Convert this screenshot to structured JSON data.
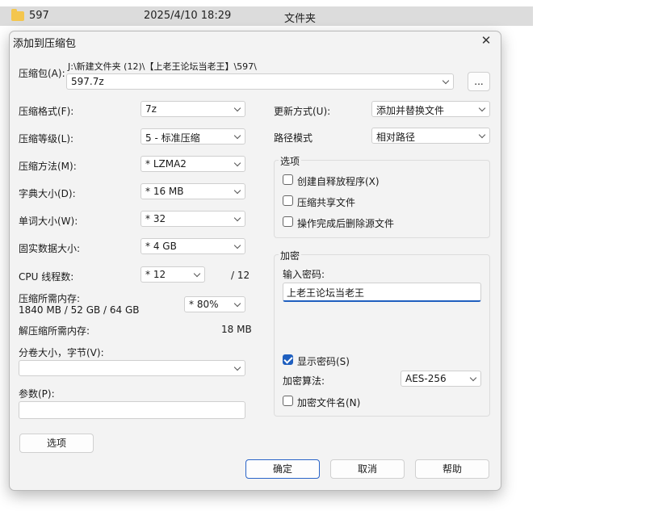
{
  "explorer": {
    "name": "597",
    "date": "2025/4/10 18:29",
    "type": "文件夹"
  },
  "dialog": {
    "title": "添加到压缩包",
    "archive_label": "压缩包(A):",
    "archive_path": "J:\\新建文件夹 (12)\\【上老王论坛当老王】\\597\\",
    "archive_name": "597.7z",
    "browse_label": "...",
    "left": {
      "format": {
        "label": "压缩格式(F):",
        "value": "7z"
      },
      "level": {
        "label": "压缩等级(L):",
        "value": "5 - 标准压缩"
      },
      "method": {
        "label": "压缩方法(M):",
        "value": "* LZMA2"
      },
      "dict": {
        "label": "字典大小(D):",
        "value": "* 16 MB"
      },
      "word": {
        "label": "单词大小(W):",
        "value": "* 32"
      },
      "solid": {
        "label": "固实数据大小:",
        "value": "* 4 GB"
      },
      "threads": {
        "label": "CPU 线程数:",
        "value": "* 12",
        "max": "/ 12"
      },
      "memory": {
        "label": "压缩所需内存:",
        "detail": "1840 MB / 52 GB / 64 GB",
        "value": "* 80%"
      },
      "decomp": {
        "label": "解压缩所需内存:",
        "value": "18 MB"
      },
      "split": {
        "label": "分卷大小，字节(V):",
        "value": ""
      },
      "params": {
        "label": "参数(P):",
        "value": ""
      },
      "options_button": "选项"
    },
    "right": {
      "update": {
        "label": "更新方式(U):",
        "value": "添加并替换文件"
      },
      "pathmode": {
        "label": "路径模式",
        "value": "相对路径"
      },
      "options": {
        "legend": "选项",
        "sfx": "创建自释放程序(X)",
        "shared": "压缩共享文件",
        "delete": "操作完成后删除源文件"
      },
      "encryption": {
        "legend": "加密",
        "password_label": "输入密码:",
        "password_value": "上老王论坛当老王",
        "show_password": "显示密码(S)",
        "method_label": "加密算法:",
        "method_value": "AES-256",
        "encrypt_names": "加密文件名(N)"
      }
    },
    "buttons": {
      "ok": "确定",
      "cancel": "取消",
      "help": "帮助"
    }
  }
}
